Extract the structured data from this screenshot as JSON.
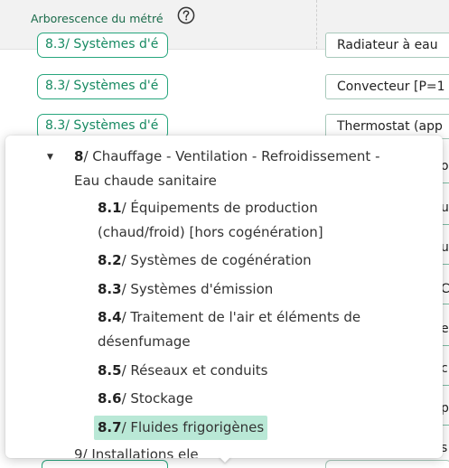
{
  "header": {
    "title": "Arborescence du métré",
    "help_icon": "question-circle-icon"
  },
  "background_rows": [
    {
      "chip": "8.3/ Systèmes d'é",
      "cell": "Radiateur à eau"
    },
    {
      "chip": "8.3/ Systèmes d'é",
      "cell": "Convecteur [P=1"
    },
    {
      "chip": "8.3/ Systèmes d'é",
      "cell": "Thermostat (app"
    }
  ],
  "right_strip_glyphs": [
    "o",
    "u",
    "u",
    "C",
    "e",
    "c",
    "p",
    "s"
  ],
  "tree": {
    "parent": {
      "code": "8",
      "label": "/ Chauffage - Ventilation - Refroidissement - Eau chaude sanitaire"
    },
    "children": [
      {
        "code": "8.1",
        "label": "/ Équipements de production (chaud/froid) [hors cogénération]"
      },
      {
        "code": "8.2",
        "label": "/ Systèmes de cogénération"
      },
      {
        "code": "8.3",
        "label": "/ Systèmes d'émission"
      },
      {
        "code": "8.4",
        "label": "/ Traitement de l'air et éléments de désenfumage"
      },
      {
        "code": "8.5",
        "label": "/ Réseaux et conduits"
      },
      {
        "code": "8.6",
        "label": "/ Stockage"
      },
      {
        "code": "8.7",
        "label": "/ Fluides frigorigènes"
      }
    ],
    "selected_index": 6,
    "next_peek": "9/ Installations ele"
  },
  "colors": {
    "accent": "#27a67d",
    "selected_bg": "#b9e8d6",
    "header_bg": "#f2f2f2"
  }
}
